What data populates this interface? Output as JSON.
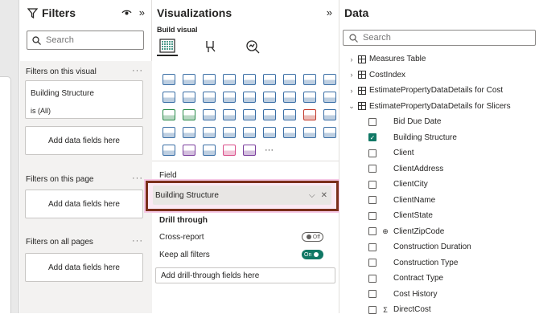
{
  "filters": {
    "title": "Filters",
    "search_placeholder": "Search",
    "on_visual_label": "Filters on this visual",
    "card_field": "Building Structure",
    "card_value": "is (All)",
    "add_fields": "Add data fields here",
    "on_page_label": "Filters on this page",
    "on_all_pages_label": "Filters on all pages",
    "more": "···"
  },
  "viz": {
    "title": "Visualizations",
    "build_visual": "Build visual",
    "field_label": "Field",
    "field_value": "Building Structure",
    "drill_through": "Drill through",
    "cross_report": "Cross-report",
    "cross_report_toggle": "Off",
    "keep_filters": "Keep all filters",
    "keep_filters_toggle": "On",
    "add_drill": "Add drill-through fields here",
    "more_visuals": "···",
    "icons": [
      {
        "name": "stacked-bar-chart-icon",
        "color": "#3a6ea5"
      },
      {
        "name": "stacked-column-chart-icon",
        "color": "#3a6ea5"
      },
      {
        "name": "clustered-bar-chart-icon",
        "color": "#3a6ea5"
      },
      {
        "name": "clustered-column-chart-icon",
        "color": "#3a6ea5"
      },
      {
        "name": "100-bar-chart-icon",
        "color": "#3a6ea5"
      },
      {
        "name": "100-column-chart-icon",
        "color": "#3a6ea5"
      },
      {
        "name": "line-chart-icon",
        "color": "#3a6ea5"
      },
      {
        "name": "area-chart-icon",
        "color": "#3a6ea5"
      },
      {
        "name": "stacked-area-chart-icon",
        "color": "#3a6ea5"
      },
      {
        "name": "line-stacked-column-icon",
        "color": "#3a6ea5"
      },
      {
        "name": "line-clustered-column-icon",
        "color": "#3a6ea5"
      },
      {
        "name": "ribbon-chart-icon",
        "color": "#3a6ea5"
      },
      {
        "name": "waterfall-chart-icon",
        "color": "#3a6ea5"
      },
      {
        "name": "funnel-chart-icon",
        "color": "#3a6ea5"
      },
      {
        "name": "scatter-chart-icon",
        "color": "#3a6ea5"
      },
      {
        "name": "pie-chart-icon",
        "color": "#3a6ea5"
      },
      {
        "name": "donut-chart-icon",
        "color": "#3a6ea5"
      },
      {
        "name": "treemap-icon",
        "color": "#3a6ea5"
      },
      {
        "name": "map-icon",
        "color": "#2a8a4a"
      },
      {
        "name": "filled-map-icon",
        "color": "#2a8a4a"
      },
      {
        "name": "shape-map-icon",
        "color": "#3a6ea5"
      },
      {
        "name": "azure-map-icon",
        "color": "#3a6ea5"
      },
      {
        "name": "gauge-icon",
        "color": "#3a6ea5"
      },
      {
        "name": "card-icon",
        "color": "#3a6ea5"
      },
      {
        "name": "multi-row-card-icon",
        "color": "#3a6ea5"
      },
      {
        "name": "kpi-icon",
        "color": "#c0392b"
      },
      {
        "name": "slicer-icon",
        "color": "#3a6ea5"
      },
      {
        "name": "table-icon",
        "color": "#3a6ea5"
      },
      {
        "name": "matrix-icon",
        "color": "#3a6ea5"
      },
      {
        "name": "r-visual-icon",
        "color": "#3a6ea5"
      },
      {
        "name": "python-visual-icon",
        "color": "#3a6ea5"
      },
      {
        "name": "key-influencers-icon",
        "color": "#3a6ea5"
      },
      {
        "name": "decomposition-tree-icon",
        "color": "#3a6ea5"
      },
      {
        "name": "qa-icon",
        "color": "#3a6ea5"
      },
      {
        "name": "narrative-icon",
        "color": "#3a6ea5"
      },
      {
        "name": "goals-icon",
        "color": "#3a6ea5"
      },
      {
        "name": "paginated-report-icon",
        "color": "#3a6ea5"
      },
      {
        "name": "power-apps-icon",
        "color": "#7a3e9d"
      },
      {
        "name": "power-automate-icon",
        "color": "#3a6ea5"
      },
      {
        "name": "metrics-icon",
        "color": "#d94f8a"
      },
      {
        "name": "diamond-visual-icon",
        "color": "#7a3e9d"
      }
    ]
  },
  "data": {
    "title": "Data",
    "search_placeholder": "Search",
    "tables": [
      {
        "label": "Measures Table",
        "expanded": false
      },
      {
        "label": "CostIndex",
        "expanded": false
      },
      {
        "label": "EstimatePropertyDataDetails for Cost",
        "expanded": false
      },
      {
        "label": "EstimatePropertyDataDetails for Slicers",
        "expanded": true
      }
    ],
    "fields": [
      {
        "label": "Bid Due Date",
        "checked": false,
        "icon": ""
      },
      {
        "label": "Building Structure",
        "checked": true,
        "icon": ""
      },
      {
        "label": "Client",
        "checked": false,
        "icon": ""
      },
      {
        "label": "ClientAddress",
        "checked": false,
        "icon": ""
      },
      {
        "label": "ClientCity",
        "checked": false,
        "icon": ""
      },
      {
        "label": "ClientName",
        "checked": false,
        "icon": ""
      },
      {
        "label": "ClientState",
        "checked": false,
        "icon": ""
      },
      {
        "label": "ClientZipCode",
        "checked": false,
        "icon": "globe"
      },
      {
        "label": "Construction Duration",
        "checked": false,
        "icon": ""
      },
      {
        "label": "Construction Type",
        "checked": false,
        "icon": ""
      },
      {
        "label": "Contract Type",
        "checked": false,
        "icon": ""
      },
      {
        "label": "Cost History",
        "checked": false,
        "icon": ""
      },
      {
        "label": "DirectCost",
        "checked": false,
        "icon": "sigma"
      }
    ]
  }
}
